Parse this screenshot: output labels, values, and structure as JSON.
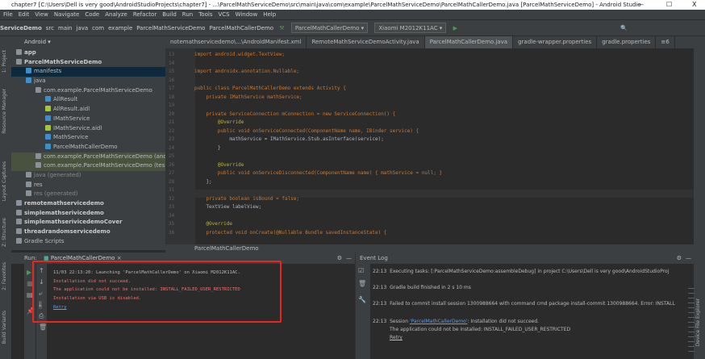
{
  "window": {
    "title": "chapter7 [C:\\Users\\Dell is very good\\AndroidStudioProjects\\chapter7] - ...\\ParcelMathServiceDemo\\src\\main\\java\\com\\example\\ParcelMathServiceDemo\\ParcelMathCallerDemo.java [ParcelMathServiceDemo] - Android Studio",
    "minimize": "—",
    "maximize": "☐",
    "close": "X"
  },
  "menu": [
    "File",
    "Edit",
    "View",
    "Navigate",
    "Code",
    "Analyze",
    "Refactor",
    "Build",
    "Run",
    "Tools",
    "VCS",
    "Window",
    "Help"
  ],
  "breadcrumb": [
    "ServiceDemo",
    "src",
    "main",
    "java",
    "com",
    "example",
    "ParcelMathServiceDemo",
    "ParcelMathCallerDemo"
  ],
  "toolbar": {
    "run_config": "ParcelMathCallerDemo ▾",
    "device": "Xiaomi M2012K11AC ▾"
  },
  "project_view": "Android ▾",
  "editor_tabs": [
    {
      "label": "notemathservicedemo\\...\\AndroidManifest.xml"
    },
    {
      "label": "RemoteMathServiceDemoActivity.java"
    },
    {
      "label": "ParcelMathCallerDemo.java",
      "active": true
    },
    {
      "label": "gradle-wrapper.properties"
    },
    {
      "label": "gradle.properties"
    },
    {
      "label": "≡6"
    }
  ],
  "side_tools_left": [
    "1: Project",
    "Resource Manager",
    "Layout Captures",
    "Z: Structure",
    "2: Favorites",
    "Build Variants"
  ],
  "side_tools_right": [
    "Device File Explorer"
  ],
  "tree": [
    {
      "label": "app",
      "depth": 0,
      "bold": true
    },
    {
      "label": "ParcelMathServiceDemo",
      "depth": 0,
      "bold": true
    },
    {
      "label": "manifests",
      "depth": 1,
      "selected": true
    },
    {
      "label": "java",
      "depth": 1
    },
    {
      "label": "com.example.ParcelMathServiceDemo",
      "depth": 2
    },
    {
      "label": "AllResult",
      "depth": 3
    },
    {
      "label": "AllResult.aidl",
      "depth": 3
    },
    {
      "label": "IMathService",
      "depth": 3
    },
    {
      "label": "IMathService.aidl",
      "depth": 3
    },
    {
      "label": "MathService",
      "depth": 3
    },
    {
      "label": "ParcelMathCallerDemo",
      "depth": 3
    },
    {
      "label": "com.example.ParcelMathServiceDemo (and",
      "depth": 2,
      "hl": true
    },
    {
      "label": "com.example.ParcelMathServiceDemo (tes",
      "depth": 2,
      "hl": true
    },
    {
      "label": "java (generated)",
      "depth": 1
    },
    {
      "label": "res",
      "depth": 1
    },
    {
      "label": "res (generated)",
      "depth": 1
    },
    {
      "label": "remotemathservicedemo",
      "depth": 0,
      "bold": true
    },
    {
      "label": "simplemathserivicedemo",
      "depth": 0,
      "bold": true
    },
    {
      "label": "simplemathserivicedemoCover",
      "depth": 0,
      "bold": true
    },
    {
      "label": "threadrandomservicedemo",
      "depth": 0,
      "bold": true
    },
    {
      "label": "Gradle Scripts",
      "depth": 0
    }
  ],
  "code_lines": [
    {
      "n": "13",
      "t": "import android.widget.TextView;"
    },
    {
      "n": "14",
      "t": ""
    },
    {
      "n": "15",
      "t": "import androidx.annotation.Nullable;"
    },
    {
      "n": "16",
      "t": ""
    },
    {
      "n": "17",
      "t": "public class ParcelMathCallerDemo extends Activity {"
    },
    {
      "n": "18",
      "t": "    private IMathService mathService;"
    },
    {
      "n": "19",
      "t": ""
    },
    {
      "n": "20",
      "t": "    private ServiceConnection mConnection = new ServiceConnection() {"
    },
    {
      "n": "21",
      "t": "        @Override"
    },
    {
      "n": "22",
      "t": "        public void onServiceConnected(ComponentName name, IBinder service) {"
    },
    {
      "n": "23",
      "t": "            mathService = IMathService.Stub.asInterface(service);"
    },
    {
      "n": "24",
      "t": "        }"
    },
    {
      "n": "25",
      "t": ""
    },
    {
      "n": "26",
      "t": "        @Override"
    },
    {
      "n": "27",
      "t": "        public void onServiceDisconnected(ComponentName name) { mathService = null; }"
    },
    {
      "n": "28",
      "t": "    };"
    },
    {
      "n": "31",
      "t": ""
    },
    {
      "n": "32",
      "t": "    private boolean isBound = false;"
    },
    {
      "n": "33",
      "t": "    TextView labelView;"
    },
    {
      "n": "34",
      "t": ""
    },
    {
      "n": "35",
      "t": "    @Override"
    },
    {
      "n": "36",
      "t": "    protected void onCreate(@Nullable Bundle savedInstanceState) {"
    }
  ],
  "editor_breadcrumb": "ParcelMathCallerDemo",
  "run": {
    "label": "Run:",
    "tab": "ParcelMathCallerDemo",
    "lines": [
      {
        "t": "11/03 22:13:20: Launching 'ParcelMathCallerDemo' on Xiaomi M2012K11AC.",
        "err": false
      },
      {
        "t": "Installation did not succeed.",
        "err": true
      },
      {
        "t": "The application could not be installed: INSTALL_FAILED_USER_RESTRICTED",
        "err": true
      },
      {
        "t": "Installation via USB is disabled.",
        "err": true
      }
    ],
    "retry": "Retry"
  },
  "event_log": {
    "title": "Event Log",
    "entries": [
      {
        "time": "22:13",
        "text": "Executing tasks: [:ParcelMathServiceDemo:assembleDebug] in project C:\\Users\\Dell is very good\\AndroidStudioProj"
      },
      {
        "time": "22:13",
        "text": "Gradle build finished in 2 s 10 ms"
      },
      {
        "time": "22:13",
        "text": "Failed to commit install session 1300988664 with command cmd package install-commit 1300988664. Error: INSTALL"
      }
    ],
    "error": {
      "time": "22:13",
      "prefix": "Session ",
      "link": "'ParcelMathCallerDemo'",
      "suffix": ": Installation did not succeed.",
      "line2": "The application could not be installed: INSTALL_FAILED_USER_RESTRICTED",
      "retry": "Retry"
    }
  },
  "colors": {
    "error": "#ff6b68",
    "link": "#589df6",
    "highlight_box": "#e8261f",
    "selection": "#0d293e"
  }
}
